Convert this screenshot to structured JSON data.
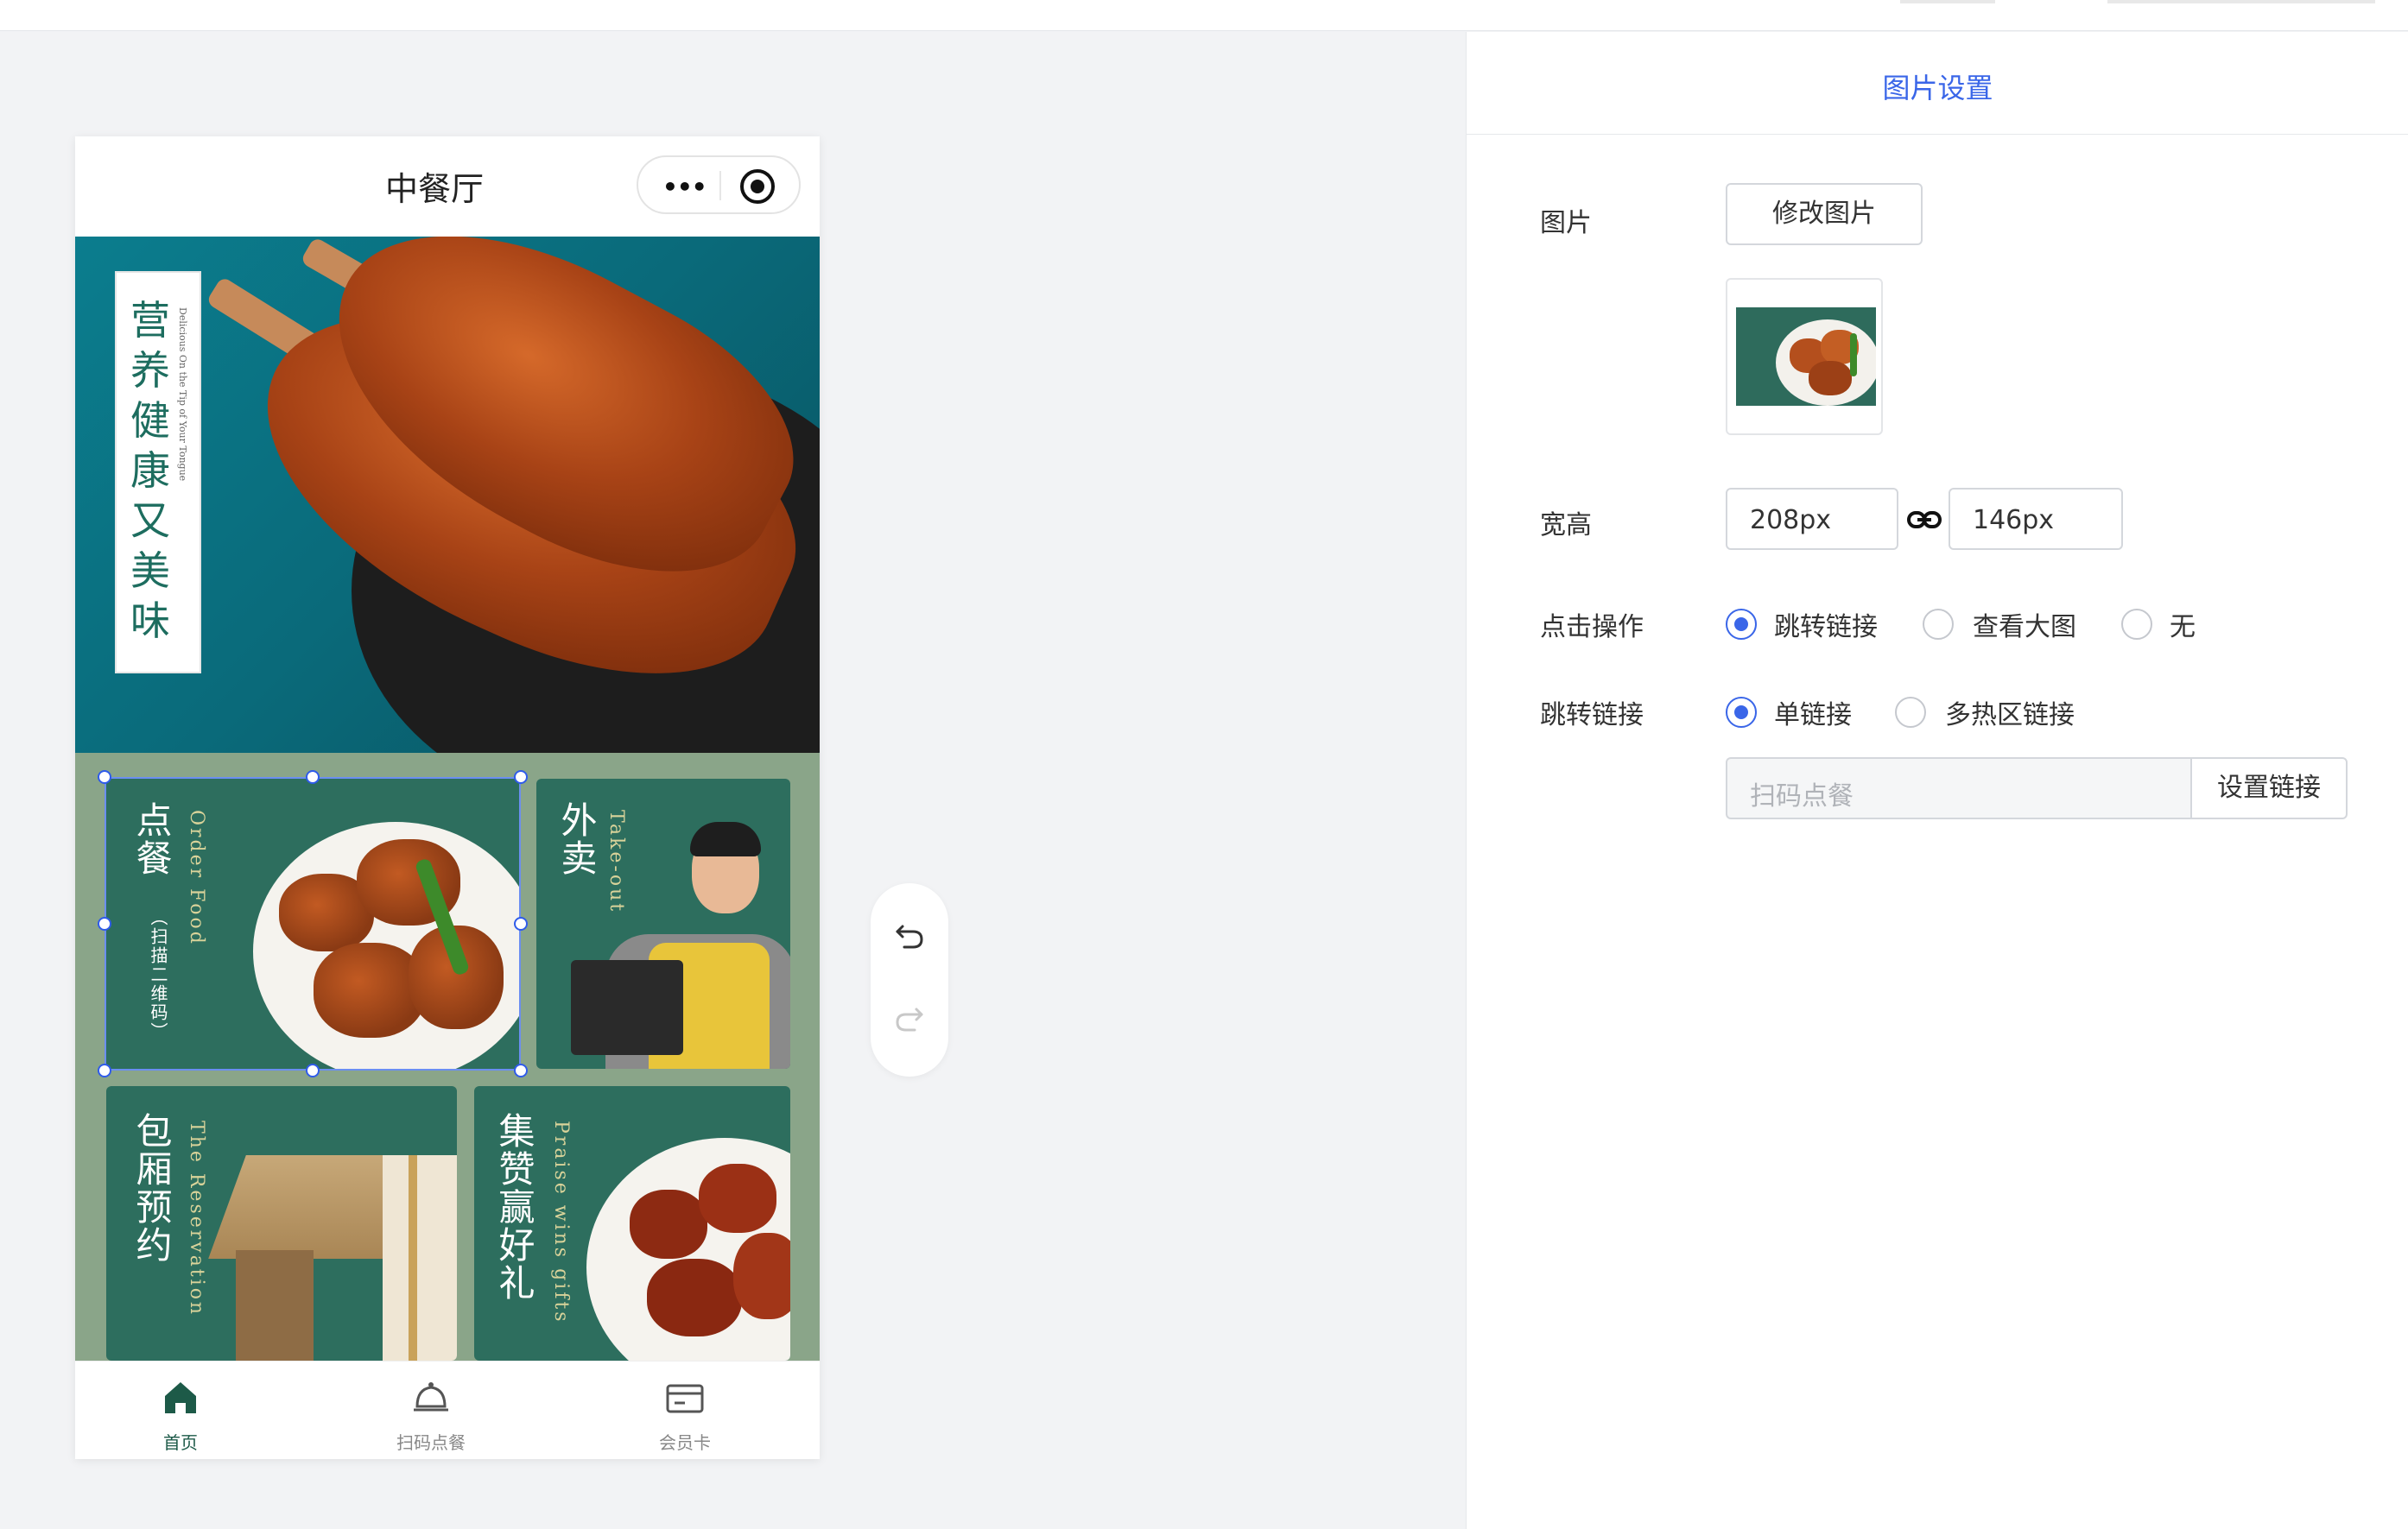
{
  "phone": {
    "title": "中餐厅",
    "banner": {
      "headline_chars": [
        "营",
        "养",
        "健",
        "康",
        "又",
        "美",
        "味"
      ],
      "tagline": "Delicious On the Tip of Your Tongue"
    },
    "cards": [
      {
        "title": "点餐",
        "en": "Order Food",
        "sub": "（扫描二维码）"
      },
      {
        "title": "外卖",
        "en": "Take-out"
      },
      {
        "title": "包厢预约",
        "en": "The Reservation"
      },
      {
        "title": "集赞赢好礼",
        "en": "Praise wins gifts"
      }
    ],
    "tabs": [
      {
        "label": "首页",
        "icon": "home-icon",
        "active": true
      },
      {
        "label": "扫码点餐",
        "icon": "scan-order-icon",
        "active": false
      },
      {
        "label": "会员卡",
        "icon": "member-card-icon",
        "active": false
      }
    ]
  },
  "panel": {
    "title": "图片设置",
    "image_label": "图片",
    "change_image_button": "修改图片",
    "size_label": "宽高",
    "width_value": "208px",
    "height_value": "146px",
    "click_action_label": "点击操作",
    "click_options": [
      {
        "label": "跳转链接",
        "selected": true
      },
      {
        "label": "查看大图",
        "selected": false
      },
      {
        "label": "无",
        "selected": false
      }
    ],
    "jump_link_label": "跳转链接",
    "link_options": [
      {
        "label": "单链接",
        "selected": true
      },
      {
        "label": "多热区链接",
        "selected": false
      }
    ],
    "link_placeholder": "扫码点餐",
    "set_link_button": "设置链接"
  },
  "colors": {
    "accent": "#3a66e8",
    "brand_green": "#2d6e5e",
    "grid_bg": "#8aa589",
    "tab_active": "#1d5a48"
  }
}
